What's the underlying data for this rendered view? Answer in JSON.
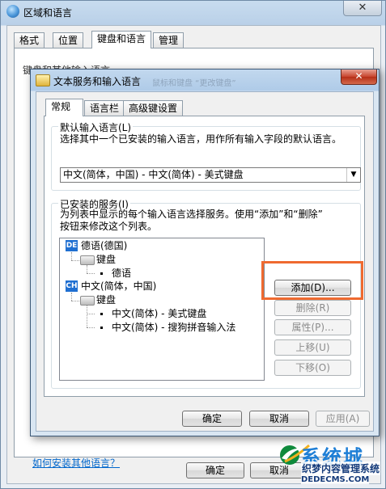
{
  "outer": {
    "title": "区域和语言",
    "close_symbol": "✕",
    "tabs": [
      "格式",
      "位置",
      "键盘和语言",
      "管理"
    ],
    "active_tab": 2,
    "group_label": "键盘和其他输入语言",
    "link_text": "如何安装其他语言？",
    "ok_label": "确定",
    "cancel_label": "取消"
  },
  "dialog": {
    "title": "文本服务和输入语言",
    "ghost_title": "鼠标和键盘 “更改键盘”",
    "close_symbol": "✕",
    "tabs": [
      "常规",
      "语言栏",
      "高级键设置"
    ],
    "active_tab": 0,
    "default_group": {
      "label": "默认输入语言(L)",
      "description": "选择其中一个已安装的输入语言，用作所有输入字段的默认语言。",
      "selected_value": "中文(简体，中国) - 中文(简体) - 美式键盘",
      "dropdown_arrow": "▼"
    },
    "services_group": {
      "label": "已安装的服务(I)",
      "description_line1": "为列表中显示的每个输入语言选择服务。使用“添加”和“删除”",
      "description_line2": "按钮来修改这个列表。"
    },
    "tree": {
      "lang1": {
        "badge": "DE",
        "name": "德语(德国)",
        "category": "键盘",
        "item": "德语"
      },
      "lang2": {
        "badge": "CH",
        "name": "中文(简体，中国)",
        "category": "键盘",
        "items": [
          "中文(简体) - 美式键盘",
          "中文(简体) - 搜狗拼音输入法"
        ]
      }
    },
    "side_buttons": {
      "add": "添加(D)...",
      "remove": "删除(R)",
      "properties": "属性(P)...",
      "move_up": "上移(U)",
      "move_down": "下移(O)"
    },
    "footer_buttons": {
      "ok": "确定",
      "cancel": "取消",
      "apply": "应用(A)"
    }
  },
  "watermark": {
    "big_text": "系统城",
    "line1": "织梦内容管理系统",
    "line2": "DEDECMS.COM"
  },
  "highlight_color": "#ef6a30",
  "badge_color": "#1f6fd1"
}
